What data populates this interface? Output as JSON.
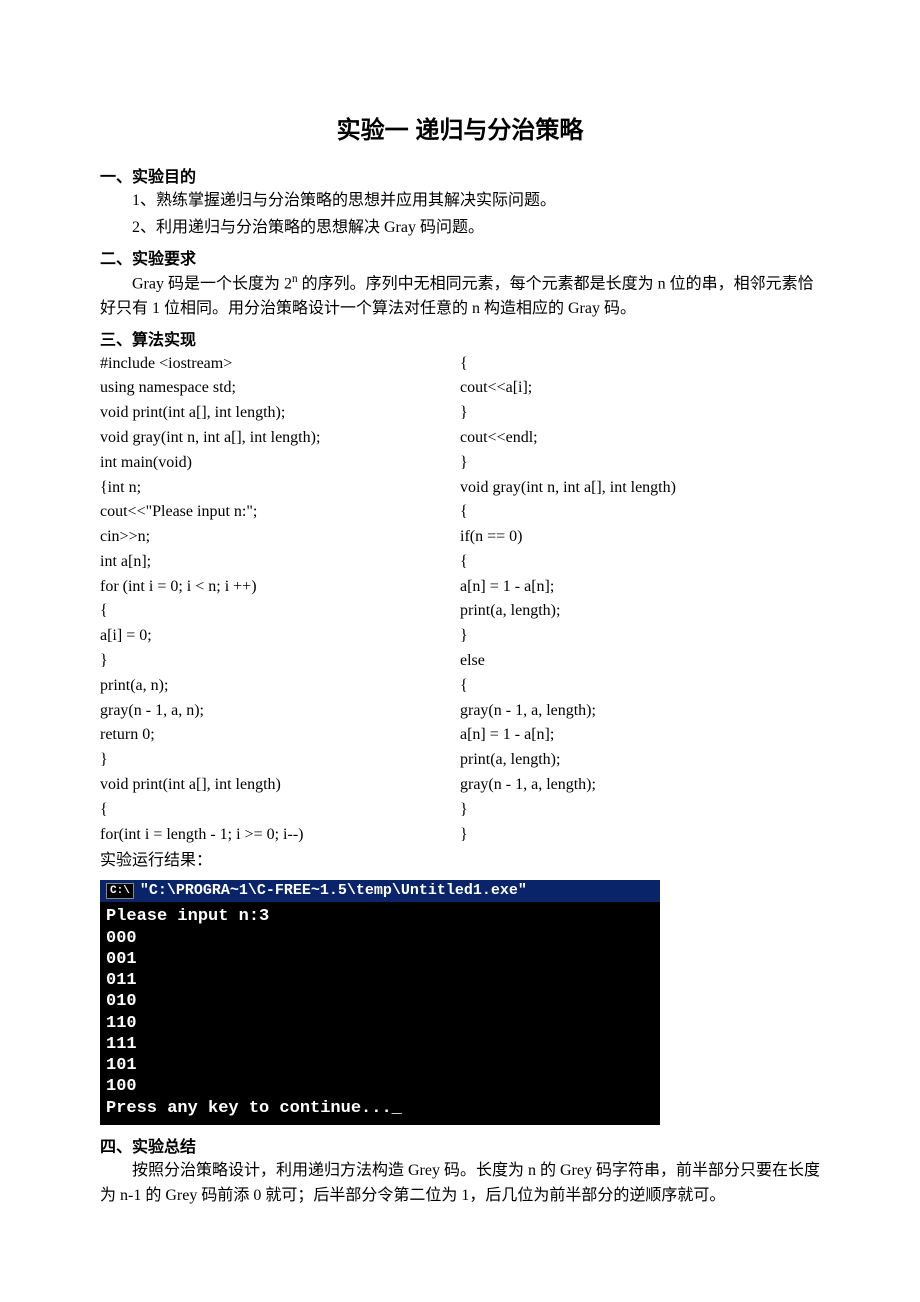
{
  "title": "实验一  递归与分治策略",
  "sec1_head": "一、实验目的",
  "sec1_p1": "1、熟练掌握递归与分治策略的思想并应用其解决实际问题。",
  "sec1_p2": "2、利用递归与分治策略的思想解决 Gray 码问题。",
  "sec2_head": "二、实验要求",
  "sec2_p1a": "Gray 码是一个长度为 2",
  "sec2_p1_sup": "n",
  "sec2_p1b": " 的序列。序列中无相同元素，每个元素都是长度为 n 位的串，相邻元素恰好只有 1 位相同。用分治策略设计一个算法对任意的 n 构造相应的 Gray 码。",
  "sec3_head": "三、算法实现",
  "code_left": "#include <iostream>\nusing namespace std;\nvoid print(int a[], int length);\nvoid gray(int n, int a[], int length);\nint main(void)\n{int n;\ncout<<\"Please input n:\";\ncin>>n;\nint a[n];\nfor (int i = 0; i < n; i ++)\n{\na[i] = 0;\n}\nprint(a, n);\ngray(n - 1, a, n);\nreturn 0;\n}\nvoid print(int a[], int length)\n{\nfor(int i = length - 1; i >= 0; i--)",
  "code_right": "{\ncout<<a[i];\n}\ncout<<endl;\n}\nvoid gray(int n, int a[], int length)\n{\nif(n == 0)\n{\na[n] = 1 - a[n];\nprint(a, length);\n}\nelse\n{\ngray(n - 1, a, length);\na[n] = 1 - a[n];\nprint(a, length);\ngray(n - 1, a, length);\n}\n}",
  "result_label": "实验运行结果：",
  "term_icon": "C:\\",
  "term_title": "\"C:\\PROGRA~1\\C-FREE~1.5\\temp\\Untitled1.exe\"",
  "term_body": "Please input n:3\n000\n001\n011\n010\n110\n111\n101\n100\nPress any key to continue..._",
  "sec4_head": "四、实验总结",
  "sec4_p1": "按照分治策略设计，利用递归方法构造 Grey 码。长度为 n 的 Grey 码字符串，前半部分只要在长度为 n-1 的 Grey 码前添 0 就可；后半部分令第二位为 1，后几位为前半部分的逆顺序就可。"
}
